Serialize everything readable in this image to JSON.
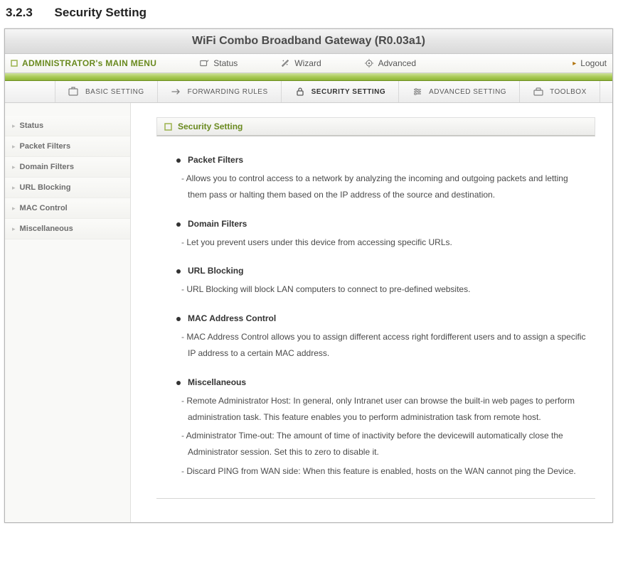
{
  "doc": {
    "section_number": "3.2.3",
    "section_title": "Security Setting"
  },
  "title_bar": "WiFi Combo Broadband Gateway (R0.03a1)",
  "main_menu": {
    "label": "ADMINISTRATOR's MAIN MENU",
    "items": [
      {
        "label": "Status"
      },
      {
        "label": "Wizard"
      },
      {
        "label": "Advanced"
      }
    ],
    "logout": "Logout"
  },
  "accent_color": "#aacb58",
  "tabs": [
    {
      "label": "BASIC SETTING",
      "active": false
    },
    {
      "label": "FORWARDING RULES",
      "active": false
    },
    {
      "label": "SECURITY SETTING",
      "active": true
    },
    {
      "label": "ADVANCED SETTING",
      "active": false
    },
    {
      "label": "TOOLBOX",
      "active": false
    }
  ],
  "sidebar": {
    "items": [
      {
        "label": "Status"
      },
      {
        "label": "Packet Filters"
      },
      {
        "label": "Domain Filters"
      },
      {
        "label": "URL Blocking"
      },
      {
        "label": "MAC Control"
      },
      {
        "label": "Miscellaneous"
      }
    ]
  },
  "panel_title": "Security Setting",
  "features": [
    {
      "title": "Packet Filters",
      "descs": [
        "Allows you to control access to a network by analyzing the incoming and outgoing packets and letting them pass or halting them based on the IP address of the source and destination."
      ]
    },
    {
      "title": "Domain Filters",
      "descs": [
        "Let you prevent users under this device from accessing specific URLs."
      ]
    },
    {
      "title": "URL Blocking",
      "descs": [
        "URL Blocking will block LAN computers to connect to pre-defined websites."
      ]
    },
    {
      "title": "MAC Address Control",
      "descs": [
        "MAC Address Control allows you to assign different access right fordifferent users and to assign a specific IP address to a certain MAC address."
      ]
    },
    {
      "title": "Miscellaneous",
      "descs": [
        "Remote Administrator Host: In general, only Intranet user can browse the built-in web pages to perform administration task. This feature enables you to perform administration task from remote host.",
        "Administrator Time-out: The amount of time of inactivity before the devicewill automatically close the Administrator session. Set this to zero to disable it.",
        "Discard PING from WAN side: When this feature is enabled, hosts on the WAN cannot ping the Device."
      ]
    }
  ]
}
